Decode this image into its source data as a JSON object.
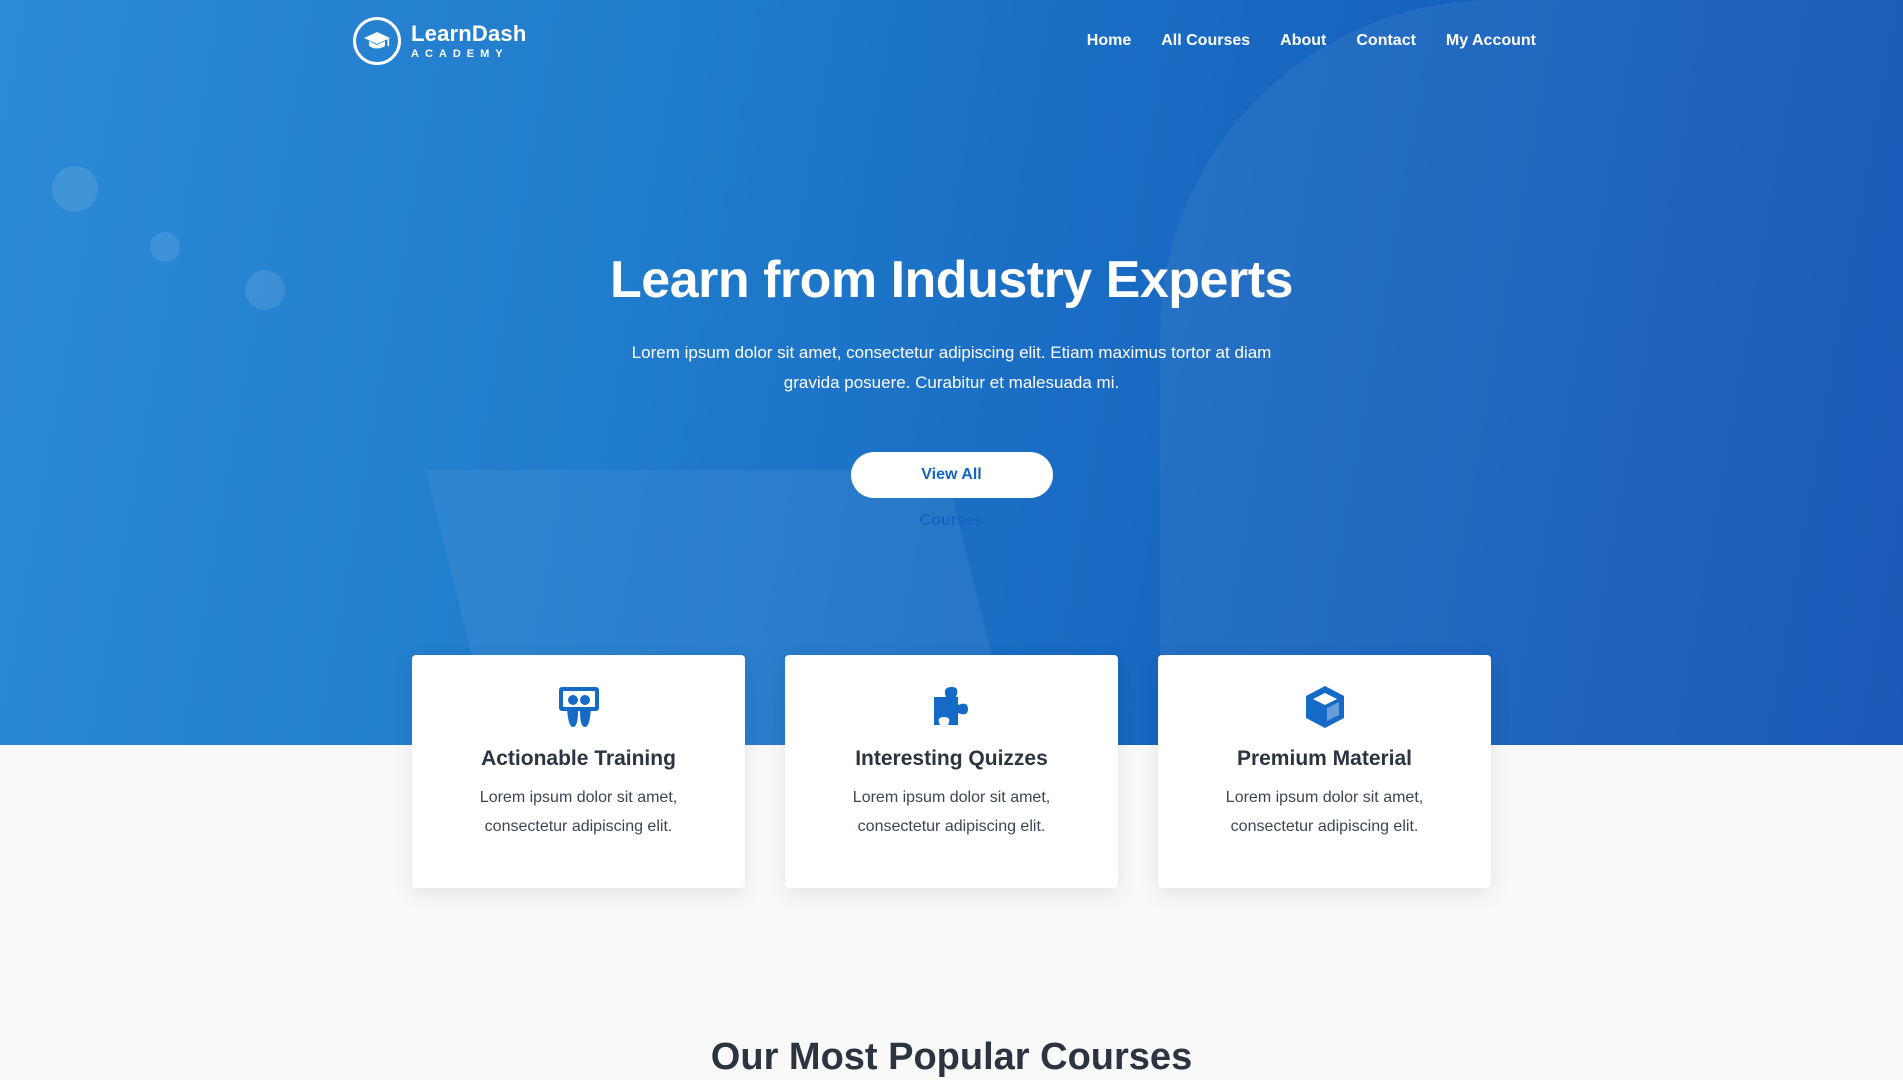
{
  "brand": {
    "name": "LearnDash",
    "tagline": "ACADEMY"
  },
  "nav": {
    "items": [
      {
        "label": "Home"
      },
      {
        "label": "All Courses"
      },
      {
        "label": "About"
      },
      {
        "label": "Contact"
      },
      {
        "label": "My Account"
      }
    ]
  },
  "hero": {
    "title": "Learn from Industry Experts",
    "text": "Lorem ipsum dolor sit amet, consectetur adipiscing elit. Etiam maximus tortor at diam gravida posuere. Curabitur et malesuada mi.",
    "button_label": "View All Courses"
  },
  "features": [
    {
      "icon": "slideshare-icon",
      "title": "Actionable Training",
      "text": "Lorem ipsum dolor sit amet, consectetur adipiscing elit."
    },
    {
      "icon": "puzzle-icon",
      "title": "Interesting Quizzes",
      "text": "Lorem ipsum dolor sit amet, consectetur adipiscing elit."
    },
    {
      "icon": "cube-icon",
      "title": "Premium Material",
      "text": "Lorem ipsum dolor sit amet, consectetur adipiscing elit."
    }
  ],
  "popular": {
    "title": "Our Most Popular Courses"
  },
  "colors": {
    "accent": "#1569c7",
    "hero": "#1f7bcb",
    "heading": "#2b3440",
    "background": "#f9f9f9"
  }
}
